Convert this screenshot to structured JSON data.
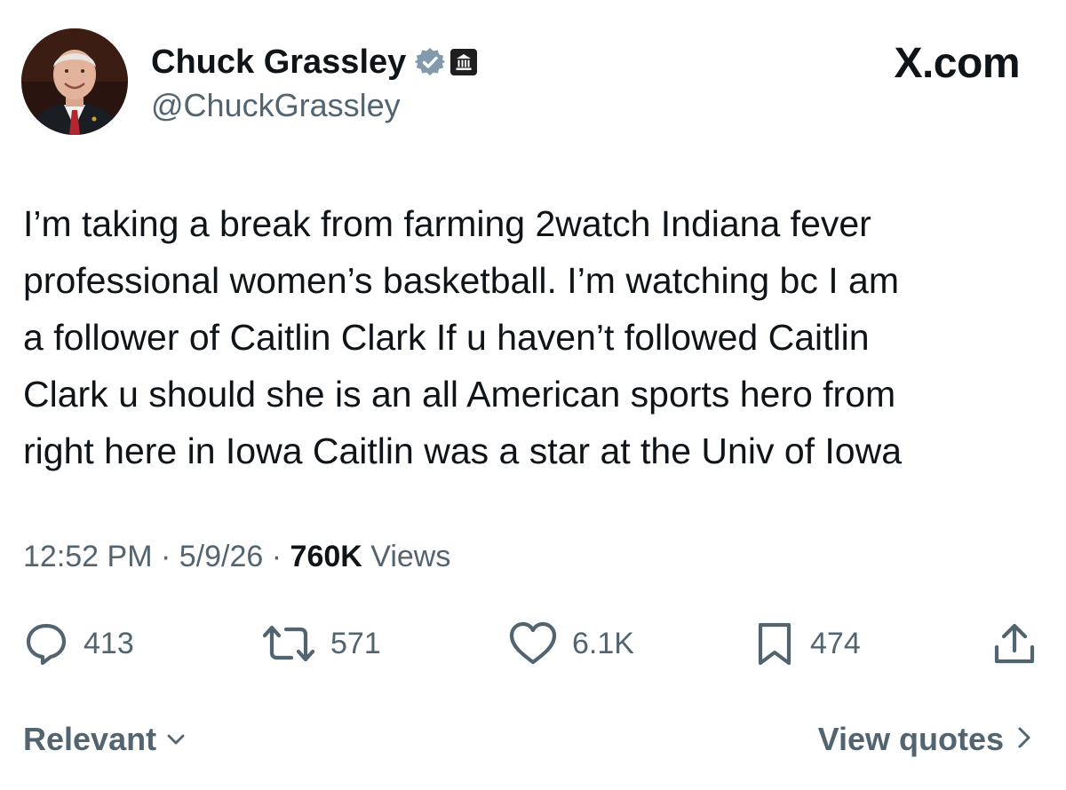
{
  "author": {
    "display_name": "Chuck Grassley",
    "handle": "@ChuckGrassley",
    "avatar_icon": "profile-photo",
    "verified_badge_icon": "verified-badge-icon",
    "affiliation_badge_icon": "government-building-icon"
  },
  "brand": {
    "label": "X.com"
  },
  "tweet": {
    "text": "I’m taking a break from farming 2watch Indiana fever\nprofessional women’s basketball. I’m watching bc I am\na follower of Caitlin Clark If u haven’t followed Caitlin\nClark u should she is an all American sports hero from\nright here in Iowa Caitlin was a star at the Univ of Iowa",
    "time": "12:52 PM",
    "separator": "·",
    "date": "5/9/26",
    "views_count": "760K",
    "views_label": "Views"
  },
  "actions": {
    "replies": {
      "icon": "reply-icon",
      "count": "413"
    },
    "reposts": {
      "icon": "repost-icon",
      "count": "571"
    },
    "likes": {
      "icon": "heart-icon",
      "count": "6.1K"
    },
    "bookmarks": {
      "icon": "bookmark-icon",
      "count": "474"
    },
    "share": {
      "icon": "share-icon"
    }
  },
  "footer": {
    "sort_label": "Relevant",
    "quotes_label": "View quotes"
  },
  "colors": {
    "primary_text": "#0f1419",
    "secondary_text": "#536471",
    "verified_badge": "#829aab",
    "background": "#ffffff"
  }
}
